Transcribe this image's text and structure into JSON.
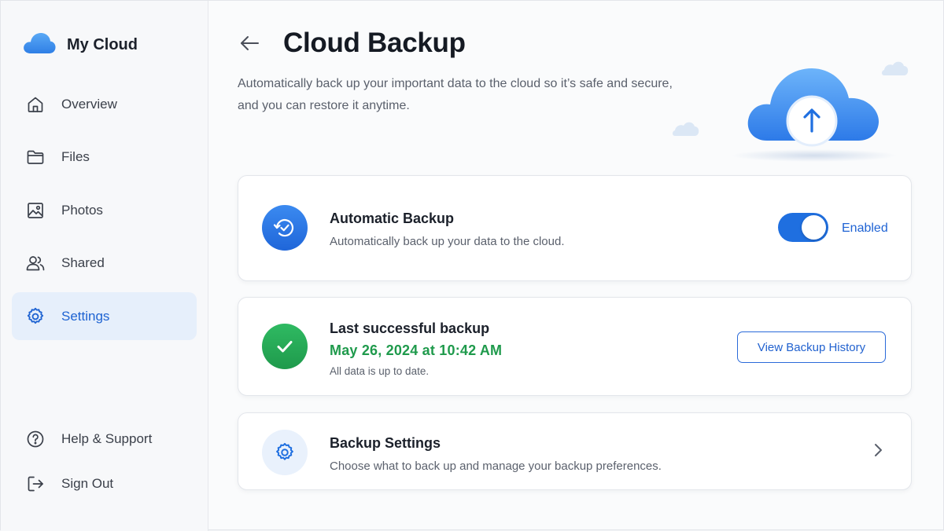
{
  "app": {
    "title": "My Cloud"
  },
  "sidebar": {
    "items": [
      {
        "label": "Overview",
        "icon": "home-icon"
      },
      {
        "label": "Files",
        "icon": "folder-icon"
      },
      {
        "label": "Photos",
        "icon": "image-icon"
      },
      {
        "label": "Shared",
        "icon": "users-icon"
      },
      {
        "label": "Settings",
        "icon": "gear-icon",
        "active": true
      }
    ],
    "bottom": [
      {
        "label": "Help & Support",
        "icon": "help-icon"
      },
      {
        "label": "Sign Out",
        "icon": "sign-out-icon"
      }
    ]
  },
  "page": {
    "title": "Cloud Backup",
    "description": "Automatically back up your important data to the cloud so it’s safe and secure, and you can restore it anytime."
  },
  "auto_backup": {
    "title": "Automatic Backup",
    "subtitle": "Automatically back up your data to the cloud.",
    "toggle_on": true,
    "status_label": "Enabled"
  },
  "last_backup": {
    "title": "Last successful backup",
    "date": "May 26, 2024 at 10:42 AM",
    "note": "All data is up to date.",
    "history_button": "View Backup History"
  },
  "backup_settings": {
    "title": "Backup Settings",
    "subtitle": "Choose what to back up and manage your backup preferences."
  },
  "colors": {
    "accent": "#1f6fe0",
    "success": "#1f9a4c",
    "active_nav_bg": "#e6effb"
  }
}
